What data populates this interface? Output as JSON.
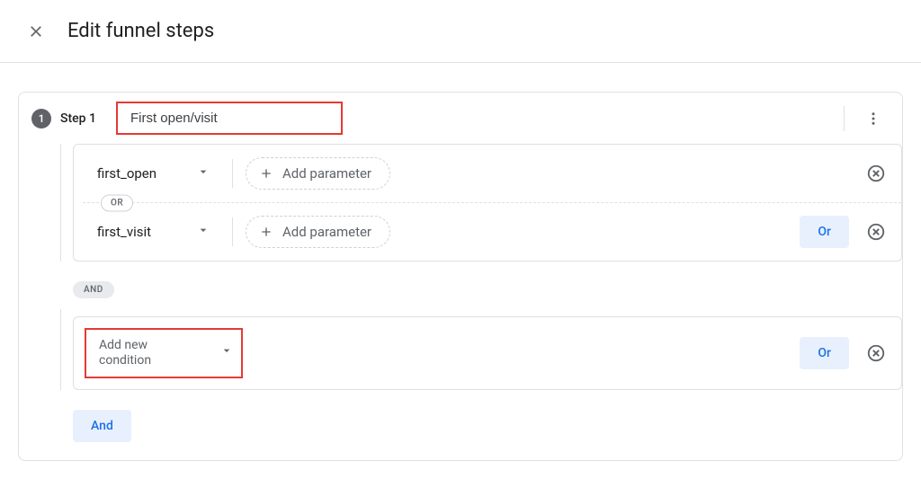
{
  "header": {
    "title": "Edit funnel steps"
  },
  "step": {
    "number": "1",
    "label": "Step 1",
    "name": "First open/visit"
  },
  "group1": {
    "row1": {
      "event": "first_open",
      "addParam": "Add parameter"
    },
    "orChip": "OR",
    "row2": {
      "event": "first_visit",
      "addParam": "Add parameter",
      "orBtn": "Or"
    }
  },
  "andChip": "AND",
  "group2": {
    "addNew": "Add new condition",
    "orBtn": "Or"
  },
  "andBtn": "And"
}
